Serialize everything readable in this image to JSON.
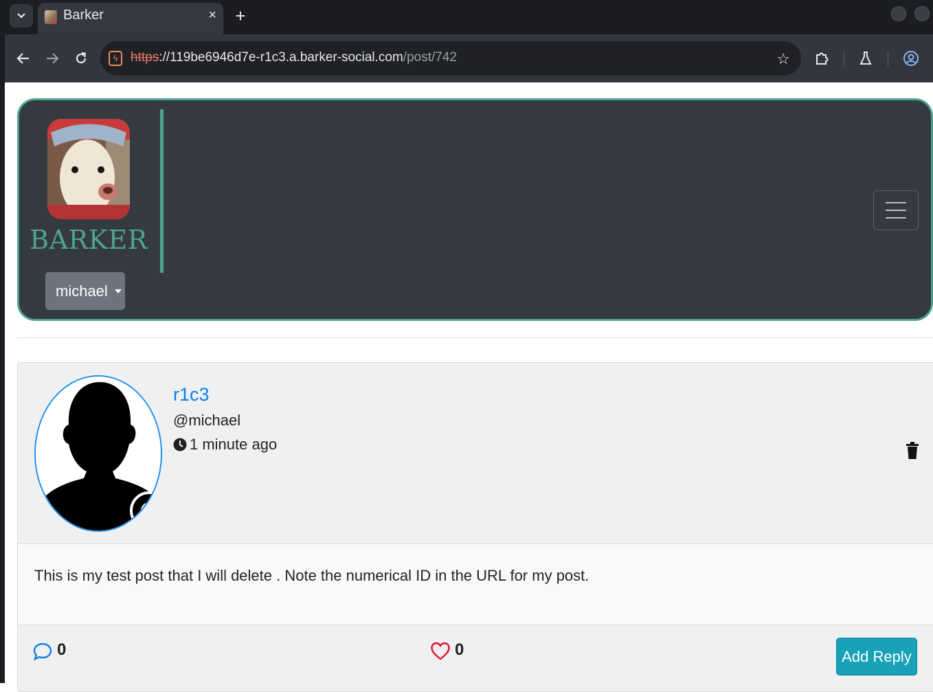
{
  "browser": {
    "tab_title": "Barker",
    "tab_close": "×",
    "new_tab": "+",
    "url_scheme": "https",
    "url_sep": "://",
    "url_host": "119be6946d7e-r1c3.a.barker-social.com",
    "url_path": "/post/742"
  },
  "navbar": {
    "brand": "BARKER",
    "user_menu_label": "michael"
  },
  "post": {
    "display_name": "r1c3",
    "handle": "@michael",
    "timestamp": "1 minute ago",
    "body": "This is my test post that I will delete . Note the numerical ID in the URL for my post.",
    "reply_count": "0",
    "like_count": "0",
    "add_reply_label": "Add Reply"
  },
  "colors": {
    "brand_teal": "#4ea38f",
    "navbar_bg": "#343a40",
    "link_blue": "#0d7ef0",
    "reply_button": "#17a2b8",
    "like_red": "#e0102a"
  }
}
